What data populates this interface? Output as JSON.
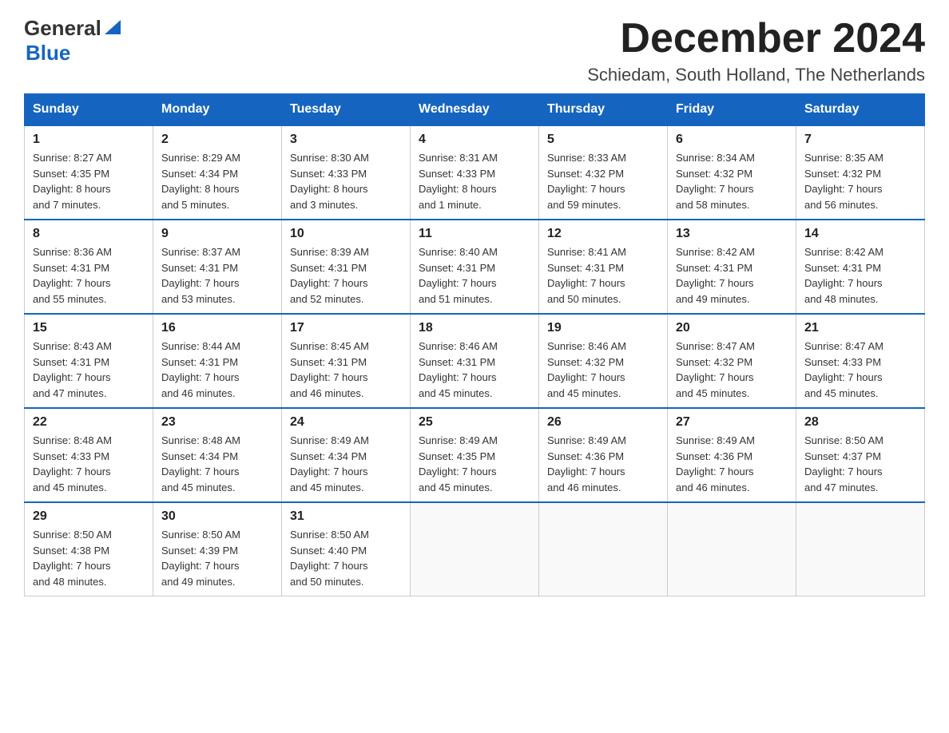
{
  "logo": {
    "general": "General",
    "blue": "Blue"
  },
  "title": "December 2024",
  "subtitle": "Schiedam, South Holland, The Netherlands",
  "days_of_week": [
    "Sunday",
    "Monday",
    "Tuesday",
    "Wednesday",
    "Thursday",
    "Friday",
    "Saturday"
  ],
  "weeks": [
    [
      {
        "day": "1",
        "sunrise": "8:27 AM",
        "sunset": "4:35 PM",
        "daylight": "8 hours and 7 minutes."
      },
      {
        "day": "2",
        "sunrise": "8:29 AM",
        "sunset": "4:34 PM",
        "daylight": "8 hours and 5 minutes."
      },
      {
        "day": "3",
        "sunrise": "8:30 AM",
        "sunset": "4:33 PM",
        "daylight": "8 hours and 3 minutes."
      },
      {
        "day": "4",
        "sunrise": "8:31 AM",
        "sunset": "4:33 PM",
        "daylight": "8 hours and 1 minute."
      },
      {
        "day": "5",
        "sunrise": "8:33 AM",
        "sunset": "4:32 PM",
        "daylight": "7 hours and 59 minutes."
      },
      {
        "day": "6",
        "sunrise": "8:34 AM",
        "sunset": "4:32 PM",
        "daylight": "7 hours and 58 minutes."
      },
      {
        "day": "7",
        "sunrise": "8:35 AM",
        "sunset": "4:32 PM",
        "daylight": "7 hours and 56 minutes."
      }
    ],
    [
      {
        "day": "8",
        "sunrise": "8:36 AM",
        "sunset": "4:31 PM",
        "daylight": "7 hours and 55 minutes."
      },
      {
        "day": "9",
        "sunrise": "8:37 AM",
        "sunset": "4:31 PM",
        "daylight": "7 hours and 53 minutes."
      },
      {
        "day": "10",
        "sunrise": "8:39 AM",
        "sunset": "4:31 PM",
        "daylight": "7 hours and 52 minutes."
      },
      {
        "day": "11",
        "sunrise": "8:40 AM",
        "sunset": "4:31 PM",
        "daylight": "7 hours and 51 minutes."
      },
      {
        "day": "12",
        "sunrise": "8:41 AM",
        "sunset": "4:31 PM",
        "daylight": "7 hours and 50 minutes."
      },
      {
        "day": "13",
        "sunrise": "8:42 AM",
        "sunset": "4:31 PM",
        "daylight": "7 hours and 49 minutes."
      },
      {
        "day": "14",
        "sunrise": "8:42 AM",
        "sunset": "4:31 PM",
        "daylight": "7 hours and 48 minutes."
      }
    ],
    [
      {
        "day": "15",
        "sunrise": "8:43 AM",
        "sunset": "4:31 PM",
        "daylight": "7 hours and 47 minutes."
      },
      {
        "day": "16",
        "sunrise": "8:44 AM",
        "sunset": "4:31 PM",
        "daylight": "7 hours and 46 minutes."
      },
      {
        "day": "17",
        "sunrise": "8:45 AM",
        "sunset": "4:31 PM",
        "daylight": "7 hours and 46 minutes."
      },
      {
        "day": "18",
        "sunrise": "8:46 AM",
        "sunset": "4:31 PM",
        "daylight": "7 hours and 45 minutes."
      },
      {
        "day": "19",
        "sunrise": "8:46 AM",
        "sunset": "4:32 PM",
        "daylight": "7 hours and 45 minutes."
      },
      {
        "day": "20",
        "sunrise": "8:47 AM",
        "sunset": "4:32 PM",
        "daylight": "7 hours and 45 minutes."
      },
      {
        "day": "21",
        "sunrise": "8:47 AM",
        "sunset": "4:33 PM",
        "daylight": "7 hours and 45 minutes."
      }
    ],
    [
      {
        "day": "22",
        "sunrise": "8:48 AM",
        "sunset": "4:33 PM",
        "daylight": "7 hours and 45 minutes."
      },
      {
        "day": "23",
        "sunrise": "8:48 AM",
        "sunset": "4:34 PM",
        "daylight": "7 hours and 45 minutes."
      },
      {
        "day": "24",
        "sunrise": "8:49 AM",
        "sunset": "4:34 PM",
        "daylight": "7 hours and 45 minutes."
      },
      {
        "day": "25",
        "sunrise": "8:49 AM",
        "sunset": "4:35 PM",
        "daylight": "7 hours and 45 minutes."
      },
      {
        "day": "26",
        "sunrise": "8:49 AM",
        "sunset": "4:36 PM",
        "daylight": "7 hours and 46 minutes."
      },
      {
        "day": "27",
        "sunrise": "8:49 AM",
        "sunset": "4:36 PM",
        "daylight": "7 hours and 46 minutes."
      },
      {
        "day": "28",
        "sunrise": "8:50 AM",
        "sunset": "4:37 PM",
        "daylight": "7 hours and 47 minutes."
      }
    ],
    [
      {
        "day": "29",
        "sunrise": "8:50 AM",
        "sunset": "4:38 PM",
        "daylight": "7 hours and 48 minutes."
      },
      {
        "day": "30",
        "sunrise": "8:50 AM",
        "sunset": "4:39 PM",
        "daylight": "7 hours and 49 minutes."
      },
      {
        "day": "31",
        "sunrise": "8:50 AM",
        "sunset": "4:40 PM",
        "daylight": "7 hours and 50 minutes."
      },
      null,
      null,
      null,
      null
    ]
  ],
  "labels": {
    "sunrise": "Sunrise:",
    "sunset": "Sunset:",
    "daylight": "Daylight:"
  },
  "accent_color": "#1565c0"
}
